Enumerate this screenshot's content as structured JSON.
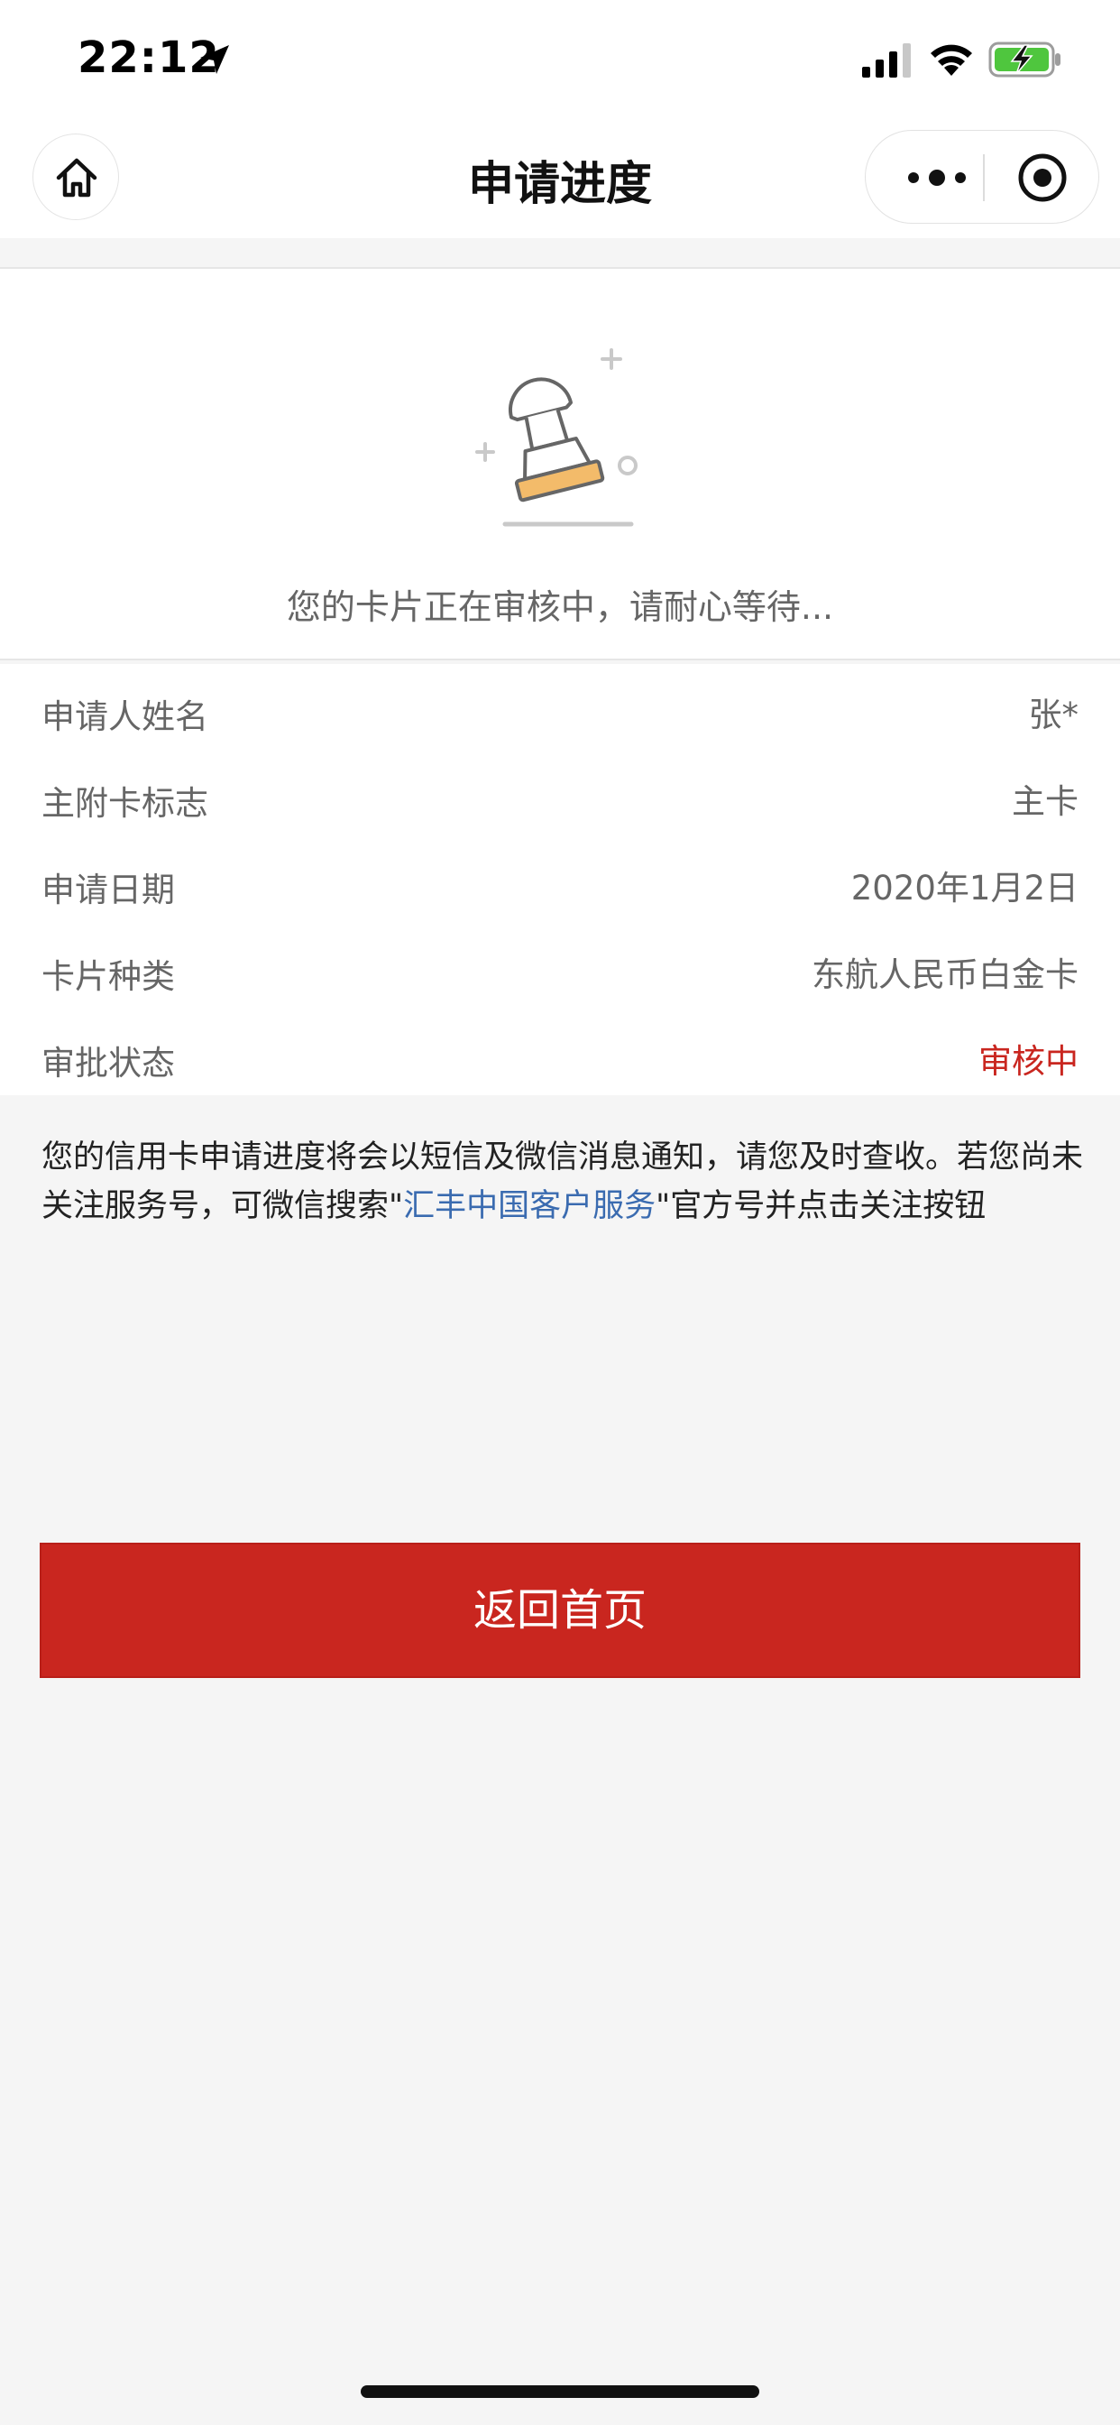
{
  "status_bar": {
    "time": "22:12"
  },
  "nav": {
    "title": "申请进度"
  },
  "review": {
    "message": "您的卡片正在审核中，请耐心等待..."
  },
  "info": [
    {
      "label": "申请人姓名",
      "value": "张*"
    },
    {
      "label": "主附卡标志",
      "value": "主卡"
    },
    {
      "label": "申请日期",
      "value": "2020年1月2日"
    },
    {
      "label": "卡片种类",
      "value": "东航人民币白金卡"
    },
    {
      "label": "审批状态",
      "value": "审核中"
    }
  ],
  "notice": {
    "text_before": "您的信用卡申请进度将会以短信及微信消息通知，请您及时查收。若您尚未关注服务号，可微信搜索\"",
    "link": "汇丰中国客户服务",
    "text_after": "\"官方号并点击关注按钮"
  },
  "return_button": {
    "label": "返回首页"
  },
  "colors": {
    "accent_red": "#c9261f",
    "link_blue": "#3a6bb0",
    "page_bg": "#f5f5f5"
  },
  "icons": {
    "location": "location-arrow-icon",
    "signal": "cellular-signal-icon",
    "wifi": "wifi-icon",
    "battery": "battery-charging-icon",
    "home": "home-icon",
    "more": "more-dots-icon",
    "close": "close-circle-icon",
    "stamp": "stamp-icon"
  }
}
